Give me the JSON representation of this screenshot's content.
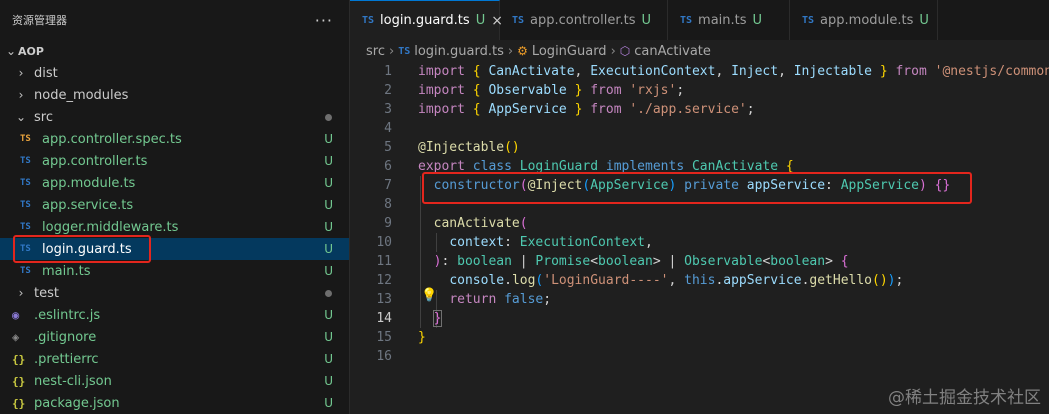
{
  "sidebar": {
    "title": "资源管理器",
    "more": "···",
    "root": "AOP",
    "items": [
      {
        "name": "dist",
        "kind": "folder",
        "twist": "›"
      },
      {
        "name": "node_modules",
        "kind": "folder",
        "twist": "›"
      },
      {
        "name": "src",
        "kind": "folder",
        "twist": "⌄"
      },
      {
        "name": "app.controller.spec.ts",
        "kind": "ts-orange",
        "icon": "TS",
        "status": "U"
      },
      {
        "name": "app.controller.ts",
        "kind": "ts",
        "icon": "TS",
        "status": "U"
      },
      {
        "name": "app.module.ts",
        "kind": "ts",
        "icon": "TS",
        "status": "U"
      },
      {
        "name": "app.service.ts",
        "kind": "ts",
        "icon": "TS",
        "status": "U"
      },
      {
        "name": "logger.middleware.ts",
        "kind": "ts",
        "icon": "TS",
        "status": "U"
      },
      {
        "name": "login.guard.ts",
        "kind": "ts",
        "icon": "TS",
        "status": "U"
      },
      {
        "name": "main.ts",
        "kind": "ts",
        "icon": "TS",
        "status": "U"
      },
      {
        "name": "test",
        "kind": "folder",
        "twist": "›"
      },
      {
        "name": ".eslintrc.js",
        "kind": "eslint",
        "icon": "◉",
        "status": "U"
      },
      {
        "name": ".gitignore",
        "kind": "git",
        "icon": "◈",
        "status": "U"
      },
      {
        "name": ".prettierrc",
        "kind": "json",
        "icon": "{}",
        "status": "U"
      },
      {
        "name": "nest-cli.json",
        "kind": "json",
        "icon": "{}",
        "status": "U"
      },
      {
        "name": "package.json",
        "kind": "json",
        "icon": "{}",
        "status": "U"
      }
    ]
  },
  "tabs": [
    {
      "icon": "TS",
      "label": "login.guard.ts",
      "status": "U",
      "close": "×"
    },
    {
      "icon": "TS",
      "label": "app.controller.ts",
      "status": "U"
    },
    {
      "icon": "TS",
      "label": "main.ts",
      "status": "U"
    },
    {
      "icon": "TS",
      "label": "app.module.ts",
      "status": "U"
    }
  ],
  "breadcrumb": {
    "folder": "src",
    "file_icon": "TS",
    "file": "login.guard.ts",
    "class": "LoginGuard",
    "method": "canActivate"
  },
  "editor": {
    "line_numbers": [
      "1",
      "2",
      "3",
      "4",
      "5",
      "6",
      "7",
      "8",
      "9",
      "10",
      "11",
      "12",
      "13",
      "14",
      "15",
      "16"
    ],
    "current_line": "14"
  },
  "watermark": "@稀土掘金技术社区",
  "colors": {
    "accent": "#0078d4",
    "highlight_box": "#e3261d",
    "selection": "#04395e",
    "untracked": "#73c991"
  }
}
